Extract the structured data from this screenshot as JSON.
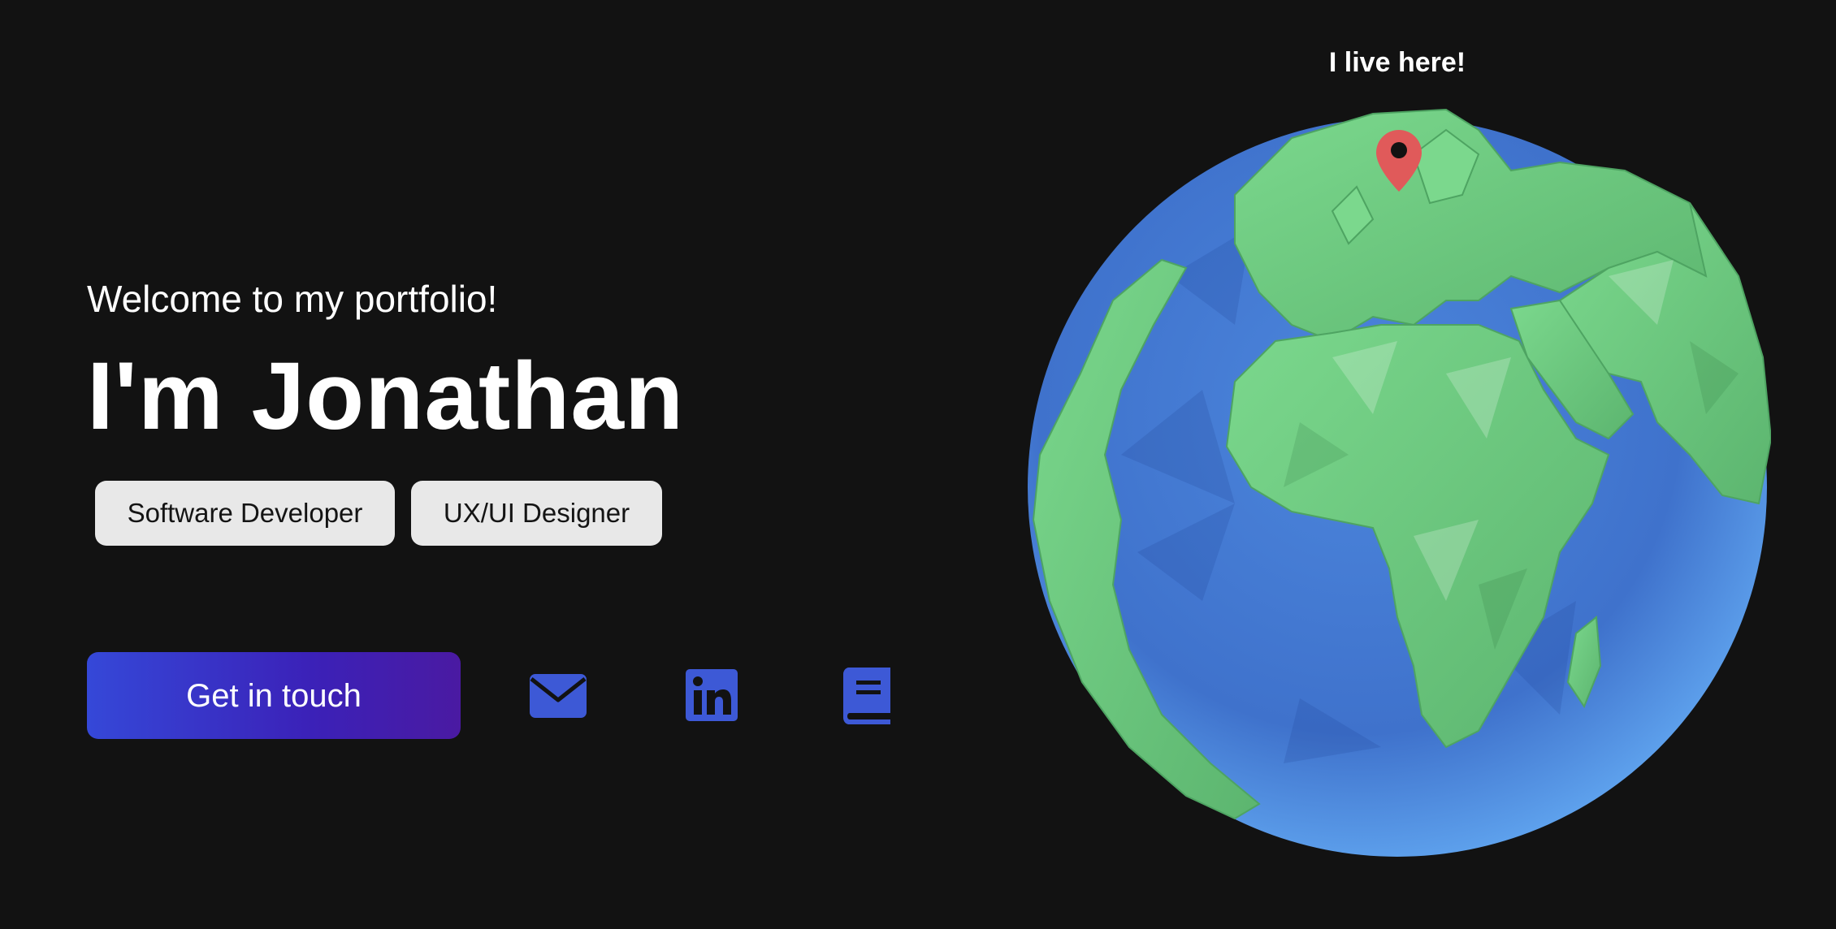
{
  "hero": {
    "welcome": "Welcome to my portfolio!",
    "name": "I'm Jonathan",
    "tags": [
      "Software Developer",
      "UX/UI Designer"
    ]
  },
  "actions": {
    "cta_label": "Get in touch",
    "social_icons": [
      "mail-icon",
      "linkedin-icon",
      "blog-book-icon"
    ]
  },
  "globe": {
    "pin_label": "I live here!",
    "pin_icon": "map-pin-icon"
  },
  "colors": {
    "background": "#121212",
    "accent": "#3a4bd6",
    "icon": "#3d59d6",
    "tag_bg": "#e8e8e8",
    "ocean": "#3f78d4",
    "land": "#6cc57e",
    "pin": "#e05a5a"
  }
}
